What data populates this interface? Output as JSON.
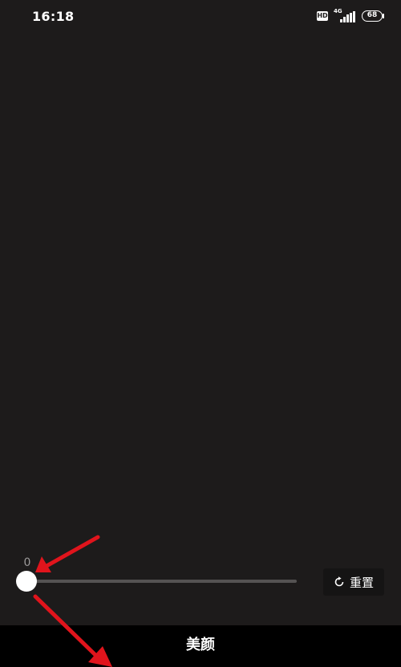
{
  "status_bar": {
    "time": "16:18",
    "hd_label": "HD",
    "network_label": "4G",
    "battery_level": "68"
  },
  "slider": {
    "value_label": "0",
    "level": 0
  },
  "reset_button": {
    "label": "重置",
    "icon": "reset-icon"
  },
  "bottom_bar": {
    "title": "美颜"
  },
  "colors": {
    "background": "#1d1b1b",
    "annotation_arrow": "#e0141c",
    "track": "#555353"
  }
}
